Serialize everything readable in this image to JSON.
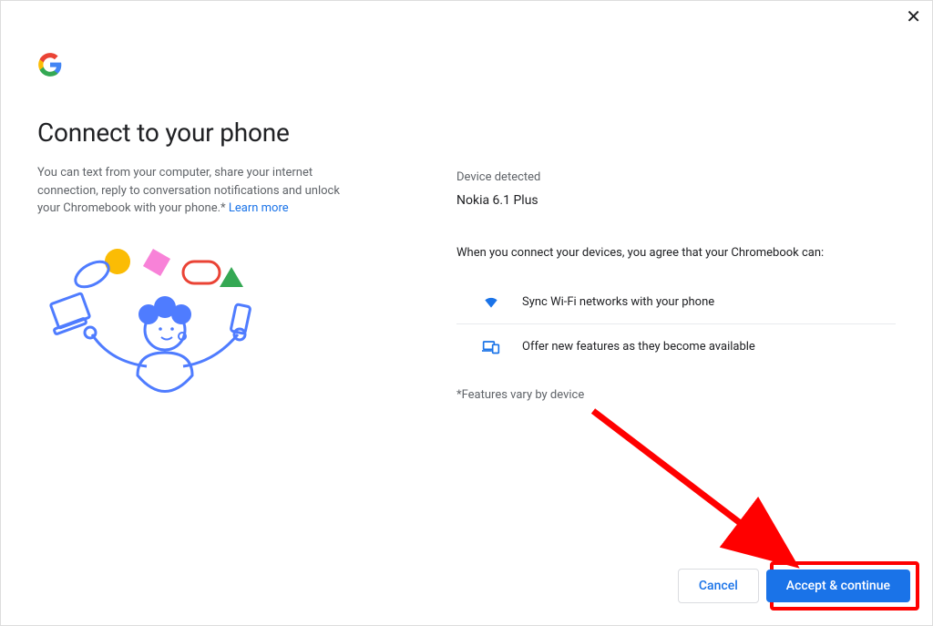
{
  "header": {
    "title": "Connect to your phone",
    "subtitle_prefix": "You can text from your computer, share your internet connection, reply to conversation notifications and unlock your Chromebook with your phone.* ",
    "learn_more": "Learn more"
  },
  "device": {
    "label": "Device detected",
    "name": "Nokia 6.1 Plus"
  },
  "agreement": {
    "intro": "When you connect your devices, you agree that your Chromebook can:",
    "features": [
      {
        "icon": "wifi-icon",
        "text": "Sync Wi-Fi networks with your phone"
      },
      {
        "icon": "devices-icon",
        "text": "Offer new features as they become available"
      }
    ],
    "footnote": "*Features vary by device"
  },
  "buttons": {
    "cancel": "Cancel",
    "accept": "Accept & continue"
  }
}
